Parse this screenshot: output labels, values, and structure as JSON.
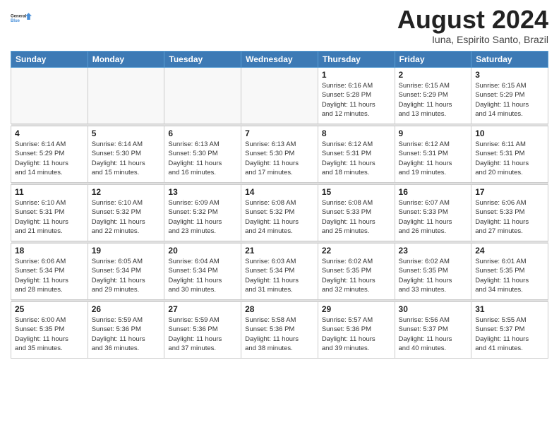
{
  "logo": {
    "general": "General",
    "blue": "Blue"
  },
  "title": {
    "month_year": "August 2024",
    "location": "Iuna, Espirito Santo, Brazil"
  },
  "weekdays": [
    "Sunday",
    "Monday",
    "Tuesday",
    "Wednesday",
    "Thursday",
    "Friday",
    "Saturday"
  ],
  "weeks": [
    [
      {
        "day": "",
        "info": ""
      },
      {
        "day": "",
        "info": ""
      },
      {
        "day": "",
        "info": ""
      },
      {
        "day": "",
        "info": ""
      },
      {
        "day": "1",
        "info": "Sunrise: 6:16 AM\nSunset: 5:28 PM\nDaylight: 11 hours\nand 12 minutes."
      },
      {
        "day": "2",
        "info": "Sunrise: 6:15 AM\nSunset: 5:29 PM\nDaylight: 11 hours\nand 13 minutes."
      },
      {
        "day": "3",
        "info": "Sunrise: 6:15 AM\nSunset: 5:29 PM\nDaylight: 11 hours\nand 14 minutes."
      }
    ],
    [
      {
        "day": "4",
        "info": "Sunrise: 6:14 AM\nSunset: 5:29 PM\nDaylight: 11 hours\nand 14 minutes."
      },
      {
        "day": "5",
        "info": "Sunrise: 6:14 AM\nSunset: 5:30 PM\nDaylight: 11 hours\nand 15 minutes."
      },
      {
        "day": "6",
        "info": "Sunrise: 6:13 AM\nSunset: 5:30 PM\nDaylight: 11 hours\nand 16 minutes."
      },
      {
        "day": "7",
        "info": "Sunrise: 6:13 AM\nSunset: 5:30 PM\nDaylight: 11 hours\nand 17 minutes."
      },
      {
        "day": "8",
        "info": "Sunrise: 6:12 AM\nSunset: 5:31 PM\nDaylight: 11 hours\nand 18 minutes."
      },
      {
        "day": "9",
        "info": "Sunrise: 6:12 AM\nSunset: 5:31 PM\nDaylight: 11 hours\nand 19 minutes."
      },
      {
        "day": "10",
        "info": "Sunrise: 6:11 AM\nSunset: 5:31 PM\nDaylight: 11 hours\nand 20 minutes."
      }
    ],
    [
      {
        "day": "11",
        "info": "Sunrise: 6:10 AM\nSunset: 5:31 PM\nDaylight: 11 hours\nand 21 minutes."
      },
      {
        "day": "12",
        "info": "Sunrise: 6:10 AM\nSunset: 5:32 PM\nDaylight: 11 hours\nand 22 minutes."
      },
      {
        "day": "13",
        "info": "Sunrise: 6:09 AM\nSunset: 5:32 PM\nDaylight: 11 hours\nand 23 minutes."
      },
      {
        "day": "14",
        "info": "Sunrise: 6:08 AM\nSunset: 5:32 PM\nDaylight: 11 hours\nand 24 minutes."
      },
      {
        "day": "15",
        "info": "Sunrise: 6:08 AM\nSunset: 5:33 PM\nDaylight: 11 hours\nand 25 minutes."
      },
      {
        "day": "16",
        "info": "Sunrise: 6:07 AM\nSunset: 5:33 PM\nDaylight: 11 hours\nand 26 minutes."
      },
      {
        "day": "17",
        "info": "Sunrise: 6:06 AM\nSunset: 5:33 PM\nDaylight: 11 hours\nand 27 minutes."
      }
    ],
    [
      {
        "day": "18",
        "info": "Sunrise: 6:06 AM\nSunset: 5:34 PM\nDaylight: 11 hours\nand 28 minutes."
      },
      {
        "day": "19",
        "info": "Sunrise: 6:05 AM\nSunset: 5:34 PM\nDaylight: 11 hours\nand 29 minutes."
      },
      {
        "day": "20",
        "info": "Sunrise: 6:04 AM\nSunset: 5:34 PM\nDaylight: 11 hours\nand 30 minutes."
      },
      {
        "day": "21",
        "info": "Sunrise: 6:03 AM\nSunset: 5:34 PM\nDaylight: 11 hours\nand 31 minutes."
      },
      {
        "day": "22",
        "info": "Sunrise: 6:02 AM\nSunset: 5:35 PM\nDaylight: 11 hours\nand 32 minutes."
      },
      {
        "day": "23",
        "info": "Sunrise: 6:02 AM\nSunset: 5:35 PM\nDaylight: 11 hours\nand 33 minutes."
      },
      {
        "day": "24",
        "info": "Sunrise: 6:01 AM\nSunset: 5:35 PM\nDaylight: 11 hours\nand 34 minutes."
      }
    ],
    [
      {
        "day": "25",
        "info": "Sunrise: 6:00 AM\nSunset: 5:35 PM\nDaylight: 11 hours\nand 35 minutes."
      },
      {
        "day": "26",
        "info": "Sunrise: 5:59 AM\nSunset: 5:36 PM\nDaylight: 11 hours\nand 36 minutes."
      },
      {
        "day": "27",
        "info": "Sunrise: 5:59 AM\nSunset: 5:36 PM\nDaylight: 11 hours\nand 37 minutes."
      },
      {
        "day": "28",
        "info": "Sunrise: 5:58 AM\nSunset: 5:36 PM\nDaylight: 11 hours\nand 38 minutes."
      },
      {
        "day": "29",
        "info": "Sunrise: 5:57 AM\nSunset: 5:36 PM\nDaylight: 11 hours\nand 39 minutes."
      },
      {
        "day": "30",
        "info": "Sunrise: 5:56 AM\nSunset: 5:37 PM\nDaylight: 11 hours\nand 40 minutes."
      },
      {
        "day": "31",
        "info": "Sunrise: 5:55 AM\nSunset: 5:37 PM\nDaylight: 11 hours\nand 41 minutes."
      }
    ]
  ]
}
